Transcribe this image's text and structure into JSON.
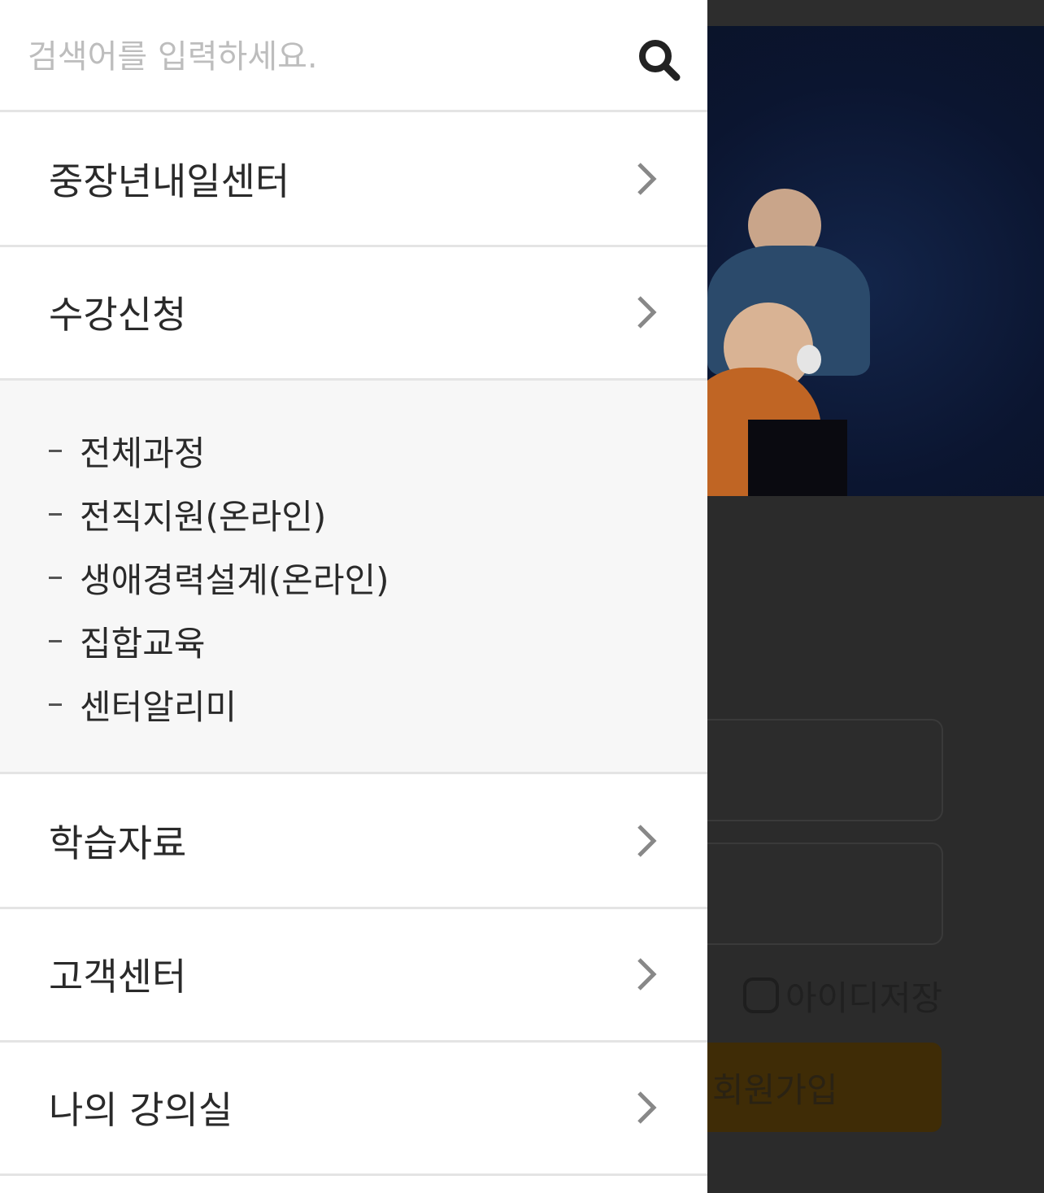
{
  "search": {
    "placeholder": "검색어를 입력하세요.",
    "icon": "search-icon"
  },
  "menu": {
    "items": [
      {
        "label": "중장년내일센터"
      },
      {
        "label": "수강신청"
      },
      {
        "label": "학습자료"
      },
      {
        "label": "고객센터"
      },
      {
        "label": "나의 강의실"
      }
    ],
    "expanded_submenu": [
      {
        "label": "전체과정"
      },
      {
        "label": "전직지원(온라인)"
      },
      {
        "label": "생애경력설계(온라인)"
      },
      {
        "label": "집합교육"
      },
      {
        "label": "센터알리미"
      }
    ]
  },
  "background_page": {
    "save_id_label": "아이디저장",
    "signup_label": "회원가입"
  },
  "colors": {
    "overlay": "#2b2b2b",
    "banner": "#0b1530",
    "accent": "#3f2c06",
    "divider": "#e4e4e4",
    "submenu_bg": "#f7f7f7"
  }
}
